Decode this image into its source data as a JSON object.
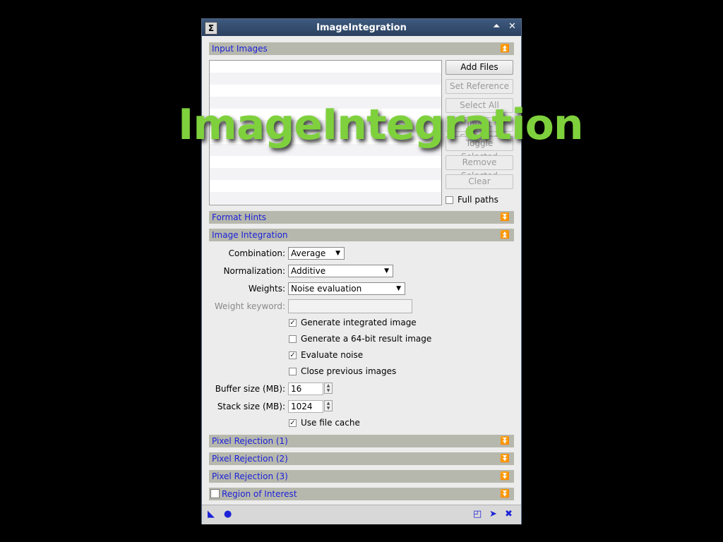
{
  "window": {
    "title": "ImageIntegration",
    "app_icon": "Σ",
    "pin_glyph": "⏶",
    "close_glyph": "✕"
  },
  "sections": {
    "input_images": {
      "label": "Input Images",
      "arrow": "⏫"
    },
    "format_hints": {
      "label": "Format Hints",
      "arrow": "⏬"
    },
    "image_integration": {
      "label": "Image Integration",
      "arrow": "⏫"
    },
    "pixel_rejection_1": {
      "label": "Pixel Rejection (1)",
      "arrow": "⏬"
    },
    "pixel_rejection_2": {
      "label": "Pixel Rejection (2)",
      "arrow": "⏬"
    },
    "pixel_rejection_3": {
      "label": "Pixel Rejection (3)",
      "arrow": "⏬"
    },
    "region_of_interest": {
      "label": "Region of Interest",
      "arrow": "⏬",
      "checked": false
    }
  },
  "input_buttons": {
    "add_files": "Add Files",
    "set_reference": "Set Reference",
    "select_all": "Select All",
    "invert_selection": "Invert Selection",
    "toggle_selected": "Toggle Selected",
    "remove_selected": "Remove Selected",
    "clear": "Clear",
    "full_paths": "Full paths",
    "full_paths_checked": false
  },
  "integration": {
    "combination_label": "Combination:",
    "combination_value": "Average",
    "normalization_label": "Normalization:",
    "normalization_value": "Additive",
    "weights_label": "Weights:",
    "weights_value": "Noise evaluation",
    "weight_keyword_label": "Weight keyword:",
    "weight_keyword_value": "",
    "generate_integrated": {
      "label": "Generate integrated image",
      "checked": true,
      "mark": "✓"
    },
    "generate_64bit": {
      "label": "Generate a 64-bit result image",
      "checked": false,
      "mark": ""
    },
    "evaluate_noise": {
      "label": "Evaluate noise",
      "checked": true,
      "mark": "✓"
    },
    "close_previous": {
      "label": "Close previous images",
      "checked": false,
      "mark": ""
    },
    "buffer_size_label": "Buffer size (MB):",
    "buffer_size_value": "16",
    "stack_size_label": "Stack size (MB):",
    "stack_size_value": "1024",
    "use_file_cache": {
      "label": "Use file cache",
      "checked": true,
      "mark": "✓"
    }
  },
  "bottom_icons": [
    "new-instance-icon",
    "apply-global-icon",
    "browse-documentation-icon",
    "track-view-icon",
    "reset-icon"
  ],
  "overlay": {
    "text": "ImageIntegration",
    "color": "#7ed13c"
  },
  "colors": {
    "section_text": "#1c22d8",
    "section_bg": "#b7b8ad",
    "title_bar": "#2f4a6e"
  }
}
